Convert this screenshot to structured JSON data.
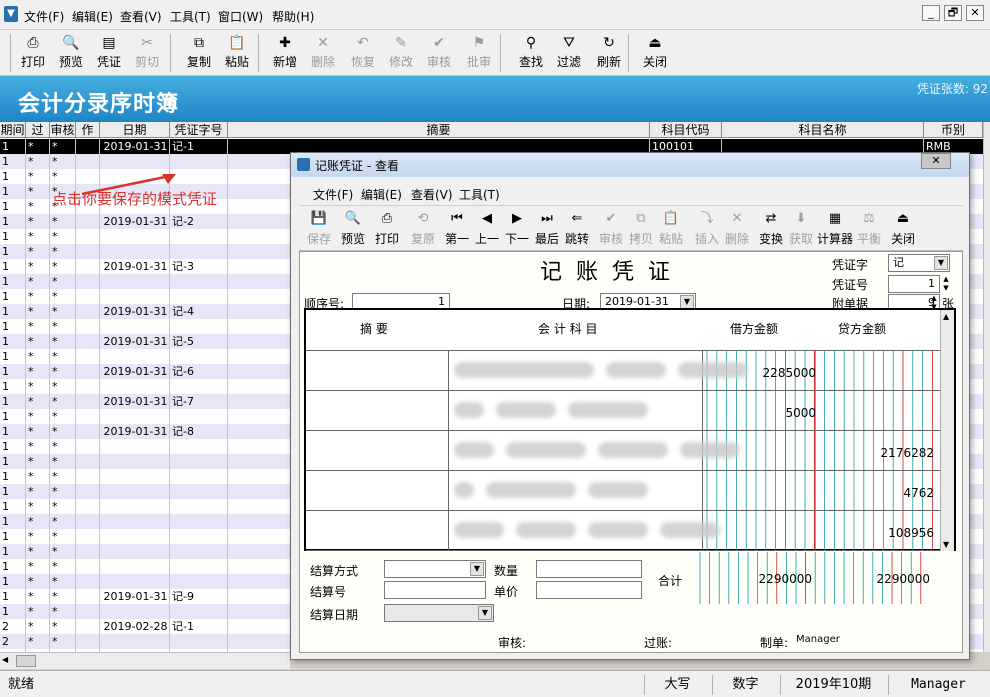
{
  "app": {
    "menus": [
      "文件(F)",
      "编辑(E)",
      "查看(V)",
      "工具(T)",
      "窗口(W)",
      "帮助(H)"
    ],
    "window_controls": [
      "_",
      "🗗",
      "✕"
    ]
  },
  "toolbar": [
    {
      "label": "打印",
      "icon": "printer-icon",
      "enabled": true
    },
    {
      "label": "预览",
      "icon": "preview-icon",
      "enabled": true
    },
    {
      "label": "凭证",
      "icon": "voucher-icon",
      "enabled": true
    },
    {
      "label": "剪切",
      "icon": "cut-icon",
      "enabled": false
    },
    {
      "label": "复制",
      "icon": "copy-icon",
      "enabled": true
    },
    {
      "label": "粘贴",
      "icon": "paste-icon",
      "enabled": true
    },
    {
      "label": "新增",
      "icon": "new-icon",
      "enabled": true
    },
    {
      "label": "删除",
      "icon": "delete-icon",
      "enabled": false
    },
    {
      "label": "恢复",
      "icon": "undo-icon",
      "enabled": false
    },
    {
      "label": "修改",
      "icon": "edit-icon",
      "enabled": false
    },
    {
      "label": "审核",
      "icon": "audit-icon",
      "enabled": false
    },
    {
      "label": "批审",
      "icon": "batch-audit-icon",
      "enabled": false
    },
    {
      "label": "查找",
      "icon": "binoculars-icon",
      "enabled": true
    },
    {
      "label": "过滤",
      "icon": "filter-icon",
      "enabled": true
    },
    {
      "label": "刷新",
      "icon": "refresh-icon",
      "enabled": true
    },
    {
      "label": "关闭",
      "icon": "exit-icon",
      "enabled": true
    }
  ],
  "banner": {
    "title": "会计分录序时簿",
    "voucher_count": "凭证张数: 92"
  },
  "grid": {
    "columns": [
      "期间",
      "过账",
      "审核",
      "作废",
      "日期",
      "凭证字号",
      "摘要",
      "科目代码",
      "科目名称",
      "币别"
    ],
    "rows": [
      {
        "period": "1",
        "posted": "*",
        "audited": "*",
        "date": "2019-01-31",
        "voucher": "记-1",
        "code": "100101",
        "currency": "RMB",
        "selected": true
      },
      {
        "period": "1",
        "posted": "*",
        "audited": "*"
      },
      {
        "period": "1",
        "posted": "*",
        "audited": "*"
      },
      {
        "period": "1",
        "posted": "*",
        "audited": "*"
      },
      {
        "period": "1",
        "posted": "*",
        "audited": "*"
      },
      {
        "period": "1",
        "posted": "*",
        "audited": "*",
        "date": "2019-01-31",
        "voucher": "记-2"
      },
      {
        "period": "1",
        "posted": "*",
        "audited": "*"
      },
      {
        "period": "1",
        "posted": "*",
        "audited": "*"
      },
      {
        "period": "1",
        "posted": "*",
        "audited": "*",
        "date": "2019-01-31",
        "voucher": "记-3"
      },
      {
        "period": "1",
        "posted": "*",
        "audited": "*"
      },
      {
        "period": "1",
        "posted": "*",
        "audited": "*"
      },
      {
        "period": "1",
        "posted": "*",
        "audited": "*",
        "date": "2019-01-31",
        "voucher": "记-4"
      },
      {
        "period": "1",
        "posted": "*",
        "audited": "*"
      },
      {
        "period": "1",
        "posted": "*",
        "audited": "*",
        "date": "2019-01-31",
        "voucher": "记-5"
      },
      {
        "period": "1",
        "posted": "*",
        "audited": "*"
      },
      {
        "period": "1",
        "posted": "*",
        "audited": "*",
        "date": "2019-01-31",
        "voucher": "记-6"
      },
      {
        "period": "1",
        "posted": "*",
        "audited": "*"
      },
      {
        "period": "1",
        "posted": "*",
        "audited": "*",
        "date": "2019-01-31",
        "voucher": "记-7"
      },
      {
        "period": "1",
        "posted": "*",
        "audited": "*"
      },
      {
        "period": "1",
        "posted": "*",
        "audited": "*",
        "date": "2019-01-31",
        "voucher": "记-8"
      },
      {
        "period": "1",
        "posted": "*",
        "audited": "*"
      },
      {
        "period": "1",
        "posted": "*",
        "audited": "*"
      },
      {
        "period": "1",
        "posted": "*",
        "audited": "*"
      },
      {
        "period": "1",
        "posted": "*",
        "audited": "*"
      },
      {
        "period": "1",
        "posted": "*",
        "audited": "*"
      },
      {
        "period": "1",
        "posted": "*",
        "audited": "*"
      },
      {
        "period": "1",
        "posted": "*",
        "audited": "*"
      },
      {
        "period": "1",
        "posted": "*",
        "audited": "*"
      },
      {
        "period": "1",
        "posted": "*",
        "audited": "*"
      },
      {
        "period": "1",
        "posted": "*",
        "audited": "*"
      },
      {
        "period": "1",
        "posted": "*",
        "audited": "*",
        "date": "2019-01-31",
        "voucher": "记-9"
      },
      {
        "period": "1",
        "posted": "*",
        "audited": "*"
      },
      {
        "period": "2",
        "posted": "*",
        "audited": "*",
        "date": "2019-02-28",
        "voucher": "记-1"
      },
      {
        "period": "2",
        "posted": "*",
        "audited": "*"
      },
      {
        "period": "2",
        "posted": "*",
        "audited": "*"
      }
    ]
  },
  "annotation": "点击你要保存的模式凭证",
  "statusbar": {
    "status": "就绪",
    "caps": "大写",
    "num": "数字",
    "period": "2019年10期",
    "user": "Manager"
  },
  "dialog": {
    "title": "记账凭证 - 查看",
    "close": "✕",
    "menus": [
      "文件(F)",
      "编辑(E)",
      "查看(V)",
      "工具(T)"
    ],
    "toolbar": [
      {
        "label": "保存",
        "icon": "save-icon",
        "enabled": false
      },
      {
        "label": "预览",
        "icon": "preview-icon",
        "enabled": true
      },
      {
        "label": "打印",
        "icon": "printer-icon",
        "enabled": true
      },
      {
        "label": "复原",
        "icon": "restore-icon",
        "enabled": false
      },
      {
        "label": "第一",
        "icon": "first-icon",
        "enabled": true
      },
      {
        "label": "上一",
        "icon": "prev-icon",
        "enabled": true
      },
      {
        "label": "下一",
        "icon": "next-icon",
        "enabled": true
      },
      {
        "label": "最后",
        "icon": "last-icon",
        "enabled": true
      },
      {
        "label": "跳转",
        "icon": "jump-icon",
        "enabled": true
      },
      {
        "label": "审核",
        "icon": "audit-icon",
        "enabled": false
      },
      {
        "label": "拷贝",
        "icon": "copy-icon",
        "enabled": false
      },
      {
        "label": "粘贴",
        "icon": "paste-icon",
        "enabled": false
      },
      {
        "label": "插入",
        "icon": "insert-icon",
        "enabled": false
      },
      {
        "label": "删除",
        "icon": "delete-icon",
        "enabled": false
      },
      {
        "label": "变换",
        "icon": "transform-icon",
        "enabled": true
      },
      {
        "label": "获取",
        "icon": "fetch-icon",
        "enabled": false
      },
      {
        "label": "计算器",
        "icon": "calculator-icon",
        "enabled": true
      },
      {
        "label": "平衡",
        "icon": "balance-icon",
        "enabled": false
      },
      {
        "label": "关闭",
        "icon": "exit-icon",
        "enabled": true
      }
    ],
    "voucher": {
      "title": "记账凭证",
      "voucher_type_label": "凭证字",
      "voucher_type": "记",
      "voucher_no_label": "凭证号",
      "voucher_no": "1",
      "attach_label": "附单据",
      "attach_count": "9",
      "attach_unit": "张",
      "seq_label": "顺序号:",
      "seq": "1",
      "date_label": "日期:",
      "date": "2019-01-31",
      "col_summary": "摘 要",
      "col_account": "会 计 科 目",
      "col_debit": "借方金额",
      "col_credit": "贷方金额",
      "entries": [
        {
          "debit": "2285000",
          "credit": ""
        },
        {
          "debit": "5000",
          "credit": ""
        },
        {
          "debit": "",
          "credit": "2176282"
        },
        {
          "debit": "",
          "credit": "4762"
        },
        {
          "debit": "",
          "credit": "108956"
        }
      ],
      "settle_method_label": "结算方式",
      "settle_no_label": "结算号",
      "settle_date_label": "结算日期",
      "qty_label": "数量",
      "price_label": "单价",
      "total_label": "合计",
      "total_debit": "2290000",
      "total_credit": "2290000",
      "audit_label": "审核:",
      "post_label": "过账:",
      "maker_label": "制单:",
      "maker": "Manager"
    }
  },
  "colors": {
    "banner": "#1f86c6",
    "selected_row": "#000000",
    "alt_row": "#e6e6f7",
    "annotation": "#d8332a",
    "debit_credit_grid": "#1a9a9a",
    "red_grid": "#cc2222"
  }
}
